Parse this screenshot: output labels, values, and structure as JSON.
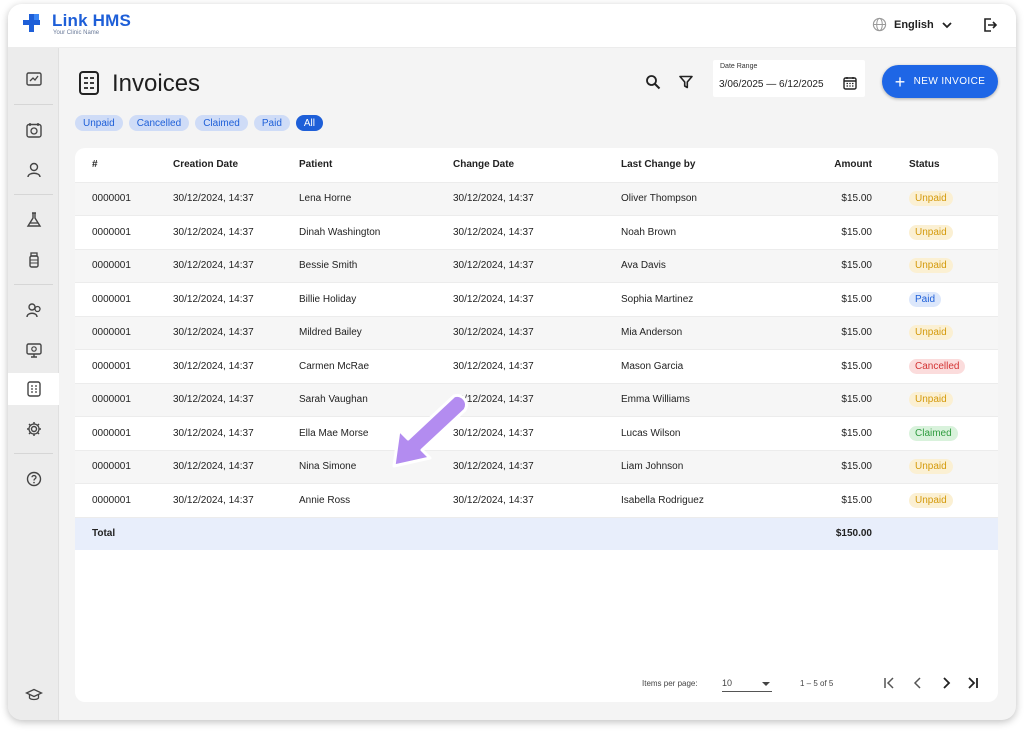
{
  "app": {
    "name": "Link HMS",
    "subtitle": "Your Clinic Name",
    "language": "English"
  },
  "page": {
    "title": "Invoices"
  },
  "date_range": {
    "label": "Date Range",
    "value": "3/06/2025 — 6/12/2025"
  },
  "new_button": {
    "label": "NEW INVOICE"
  },
  "filters": [
    "Unpaid",
    "Cancelled",
    "Claimed",
    "Paid",
    "All"
  ],
  "active_filter": "All",
  "table": {
    "headers": [
      "#",
      "Creation Date",
      "Patient",
      "Change Date",
      "Last Change by",
      "Amount",
      "Status"
    ],
    "rows": [
      {
        "id": "0000001",
        "created": "30/12/2024, 14:37",
        "patient": "Lena Horne",
        "changed": "30/12/2024, 14:37",
        "by": "Oliver Thompson",
        "amount": "$15.00",
        "status": "Unpaid"
      },
      {
        "id": "0000001",
        "created": "30/12/2024, 14:37",
        "patient": "Dinah Washington",
        "changed": "30/12/2024, 14:37",
        "by": "Noah Brown",
        "amount": "$15.00",
        "status": "Unpaid"
      },
      {
        "id": "0000001",
        "created": "30/12/2024, 14:37",
        "patient": "Bessie Smith",
        "changed": "30/12/2024, 14:37",
        "by": "Ava Davis",
        "amount": "$15.00",
        "status": "Unpaid"
      },
      {
        "id": "0000001",
        "created": "30/12/2024, 14:37",
        "patient": "Billie Holiday",
        "changed": "30/12/2024, 14:37",
        "by": "Sophia Martinez",
        "amount": "$15.00",
        "status": "Paid"
      },
      {
        "id": "0000001",
        "created": "30/12/2024, 14:37",
        "patient": "Mildred Bailey",
        "changed": "30/12/2024, 14:37",
        "by": "Mia Anderson",
        "amount": "$15.00",
        "status": "Unpaid"
      },
      {
        "id": "0000001",
        "created": "30/12/2024, 14:37",
        "patient": "Carmen McRae",
        "changed": "30/12/2024, 14:37",
        "by": "Mason Garcia",
        "amount": "$15.00",
        "status": "Cancelled"
      },
      {
        "id": "0000001",
        "created": "30/12/2024, 14:37",
        "patient": "Sarah Vaughan",
        "changed": "30/12/2024, 14:37",
        "by": "Emma Williams",
        "amount": "$15.00",
        "status": "Unpaid"
      },
      {
        "id": "0000001",
        "created": "30/12/2024, 14:37",
        "patient": "Ella Mae Morse",
        "changed": "30/12/2024, 14:37",
        "by": "Lucas Wilson",
        "amount": "$15.00",
        "status": "Claimed"
      },
      {
        "id": "0000001",
        "created": "30/12/2024, 14:37",
        "patient": "Nina Simone",
        "changed": "30/12/2024, 14:37",
        "by": "Liam Johnson",
        "amount": "$15.00",
        "status": "Unpaid"
      },
      {
        "id": "0000001",
        "created": "30/12/2024, 14:37",
        "patient": "Annie Ross",
        "changed": "30/12/2024, 14:37",
        "by": "Isabella Rodriguez",
        "amount": "$15.00",
        "status": "Unpaid"
      }
    ],
    "total_label": "Total",
    "total_amount": "$150.00"
  },
  "pagination": {
    "items_per_page_label": "Items per page:",
    "items_per_page": "10",
    "range": "1 – 5 of 5"
  },
  "sidebar_icons": [
    "dashboard-icon",
    "calendar-icon",
    "patient-icon",
    "lab-icon",
    "medicine-icon",
    "staff-icon",
    "monitor-icon",
    "invoices-icon",
    "settings-icon",
    "help-icon",
    "education-icon"
  ],
  "colors": {
    "accent": "#1e66e6",
    "annotation_arrow": "#b38cf0"
  }
}
